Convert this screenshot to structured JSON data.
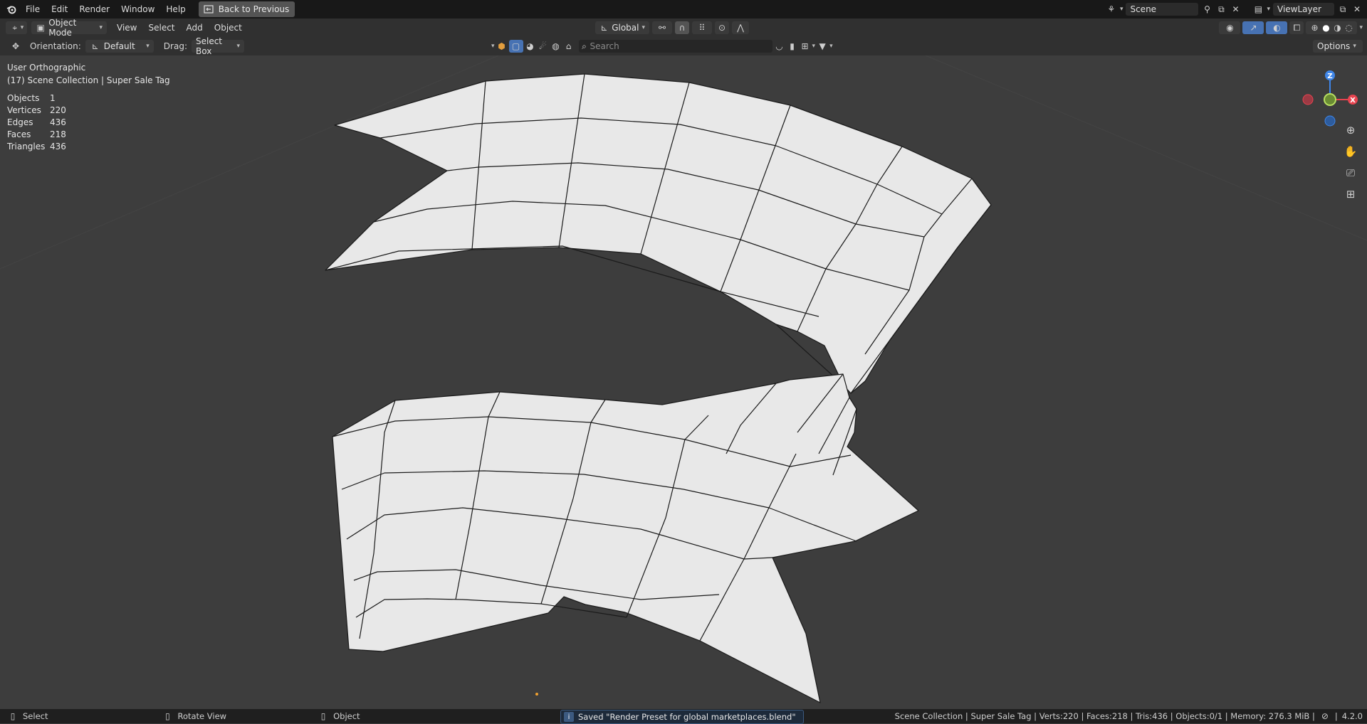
{
  "topbar": {
    "menus": [
      "File",
      "Edit",
      "Render",
      "Window",
      "Help"
    ],
    "back_button": "Back to Previous",
    "scene": "Scene",
    "view_layer": "ViewLayer"
  },
  "header": {
    "mode": "Object Mode",
    "menus": [
      "View",
      "Select",
      "Add",
      "Object"
    ],
    "transform_orientation": "Global",
    "options_label": "Options"
  },
  "tool_settings": {
    "orientation_label": "Orientation:",
    "orientation_value": "Default",
    "drag_label": "Drag:",
    "drag_value": "Select Box",
    "search_placeholder": "Search"
  },
  "viewport": {
    "view_name": "User Orthographic",
    "collection_info": "(17) Scene Collection | Super Sale Tag",
    "stats": [
      {
        "label": "Objects",
        "value": "1"
      },
      {
        "label": "Vertices",
        "value": "220"
      },
      {
        "label": "Edges",
        "value": "436"
      },
      {
        "label": "Faces",
        "value": "218"
      },
      {
        "label": "Triangles",
        "value": "436"
      }
    ],
    "gizmo_axes": {
      "z": "Z",
      "x": "X"
    },
    "mesh_fill": "#e8e8e8",
    "background": "#3d3d3d"
  },
  "statusbar": {
    "select": "Select",
    "rotate": "Rotate View",
    "object": "Object",
    "message": "Saved \"Render Preset for global marketplaces.blend\"",
    "info": "Scene Collection | Super Sale Tag | Verts:220 | Faces:218 | Tris:436 | Objects:0/1 | Memory: 276.3 MiB |",
    "version": "4.2.0"
  },
  "colors": {
    "accent": "#4772b3",
    "axis_x": "#e8434f",
    "axis_y": "#8bc34a",
    "axis_z": "#3f86e8"
  }
}
